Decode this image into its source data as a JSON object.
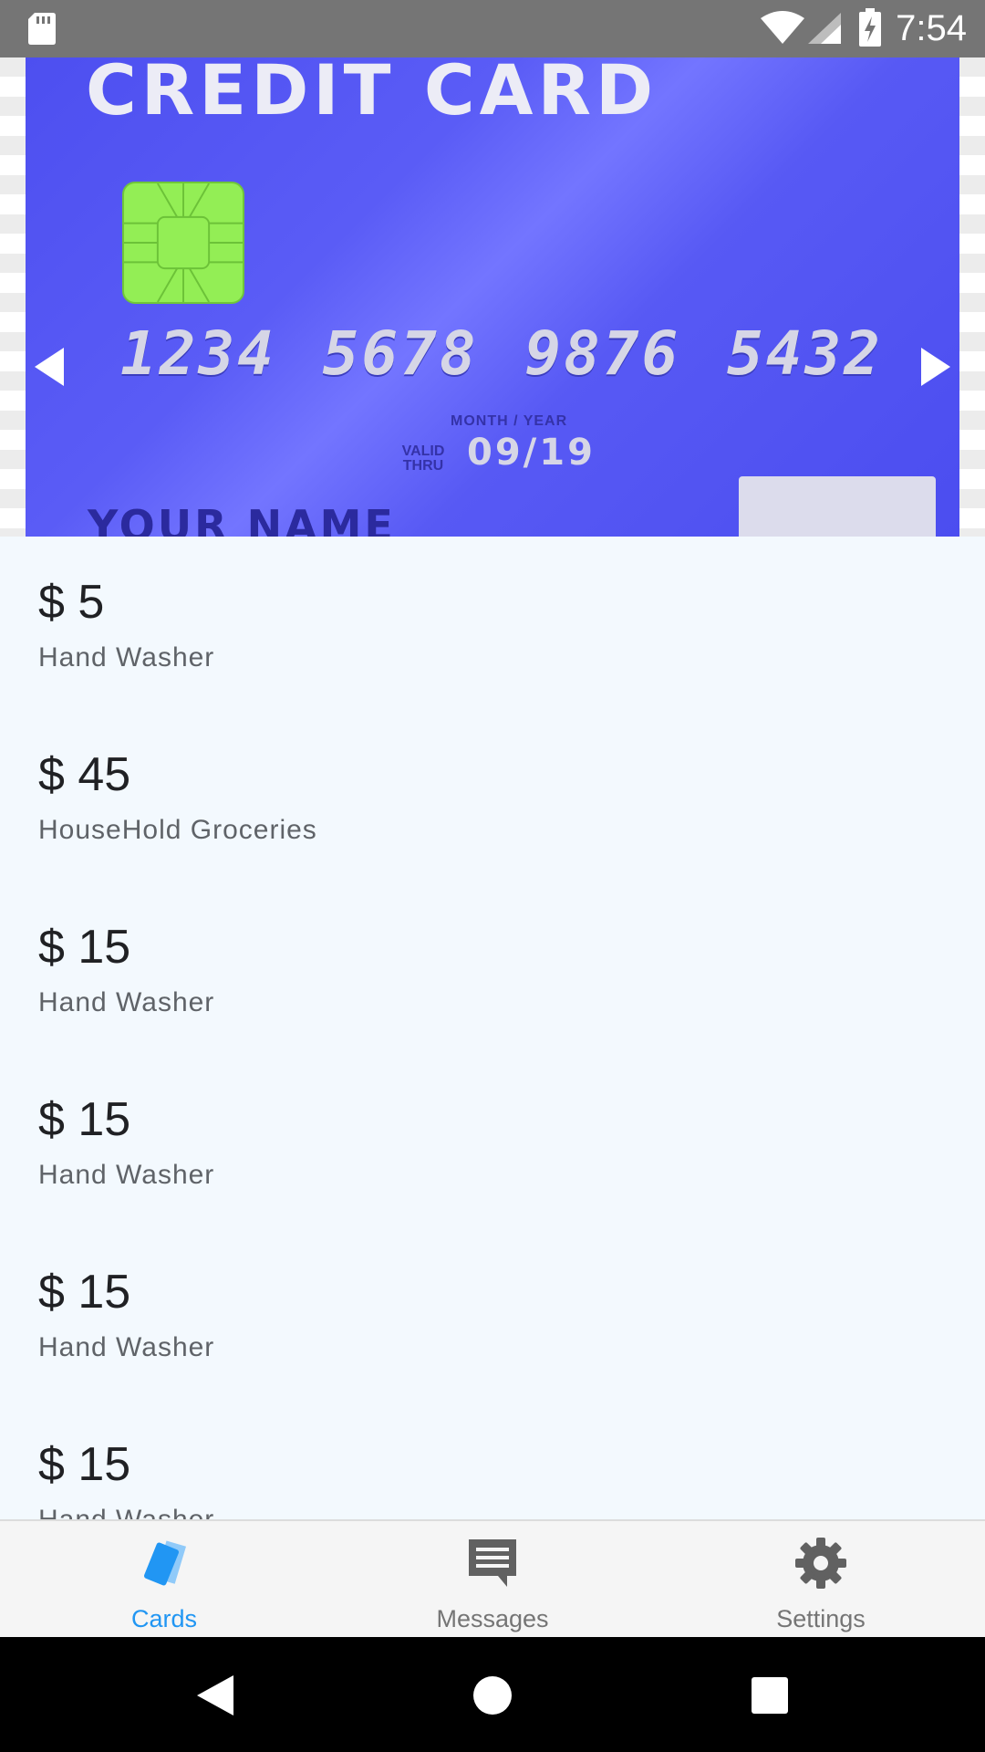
{
  "status_bar": {
    "time": "7:54",
    "icons": [
      "sd-card-icon",
      "wifi-icon",
      "cell-signal-icon",
      "battery-charging-icon"
    ]
  },
  "card": {
    "title": "CREDIT CARD",
    "number": "1234 5678 9876 5432",
    "expiry_caption": "MONTH / YEAR",
    "valid_thru": "VALID THRU",
    "expiry": "09/19",
    "holder": "YOUR NAME",
    "colors": {
      "card": "#5a5cf6",
      "chip": "#93ee55"
    }
  },
  "carousel": {
    "page_count": 2,
    "current_page": 1
  },
  "transactions": [
    {
      "amount": "$ 5",
      "label": "Hand Washer"
    },
    {
      "amount": "$ 45",
      "label": "HouseHold Groceries"
    },
    {
      "amount": "$ 15",
      "label": "Hand Washer"
    },
    {
      "amount": "$ 15",
      "label": "Hand Washer"
    },
    {
      "amount": "$ 15",
      "label": "Hand Washer"
    },
    {
      "amount": "$ 15",
      "label": "Hand Washer"
    }
  ],
  "bottom_nav": {
    "items": [
      {
        "label": "Cards",
        "icon": "cards-icon",
        "active": true
      },
      {
        "label": "Messages",
        "icon": "message-icon",
        "active": false
      },
      {
        "label": "Settings",
        "icon": "gear-icon",
        "active": false
      }
    ],
    "active_color": "#2196f3",
    "inactive_color": "#757575"
  }
}
